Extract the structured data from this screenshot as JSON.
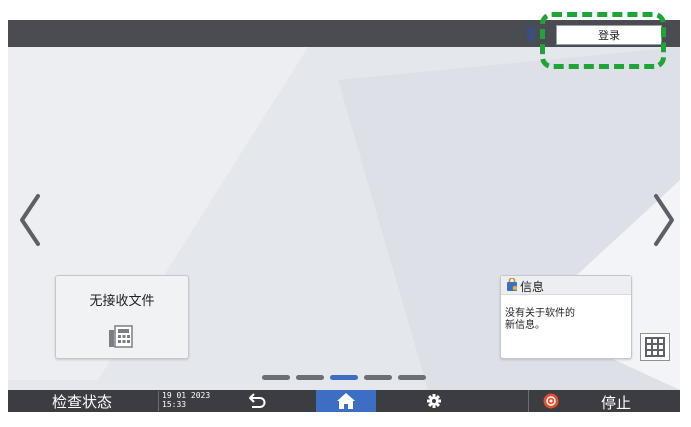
{
  "header": {
    "login_label": "登录"
  },
  "widgets": {
    "fax": {
      "title": "无接收文件",
      "icon": "fax-icon"
    },
    "info": {
      "title": "信息",
      "icon": "info-bag-icon",
      "body": "没有关于软件的\n新信息。"
    }
  },
  "pagination": {
    "pages": 5,
    "active_index": 2
  },
  "bottom_bar": {
    "check_status_label": "检查状态",
    "date": "19 01 2023",
    "time": "15:33",
    "stop_label": "停止"
  },
  "colors": {
    "highlight": "#1fa43a",
    "accent": "#3c6fc4",
    "bar": "#3b3d42"
  }
}
